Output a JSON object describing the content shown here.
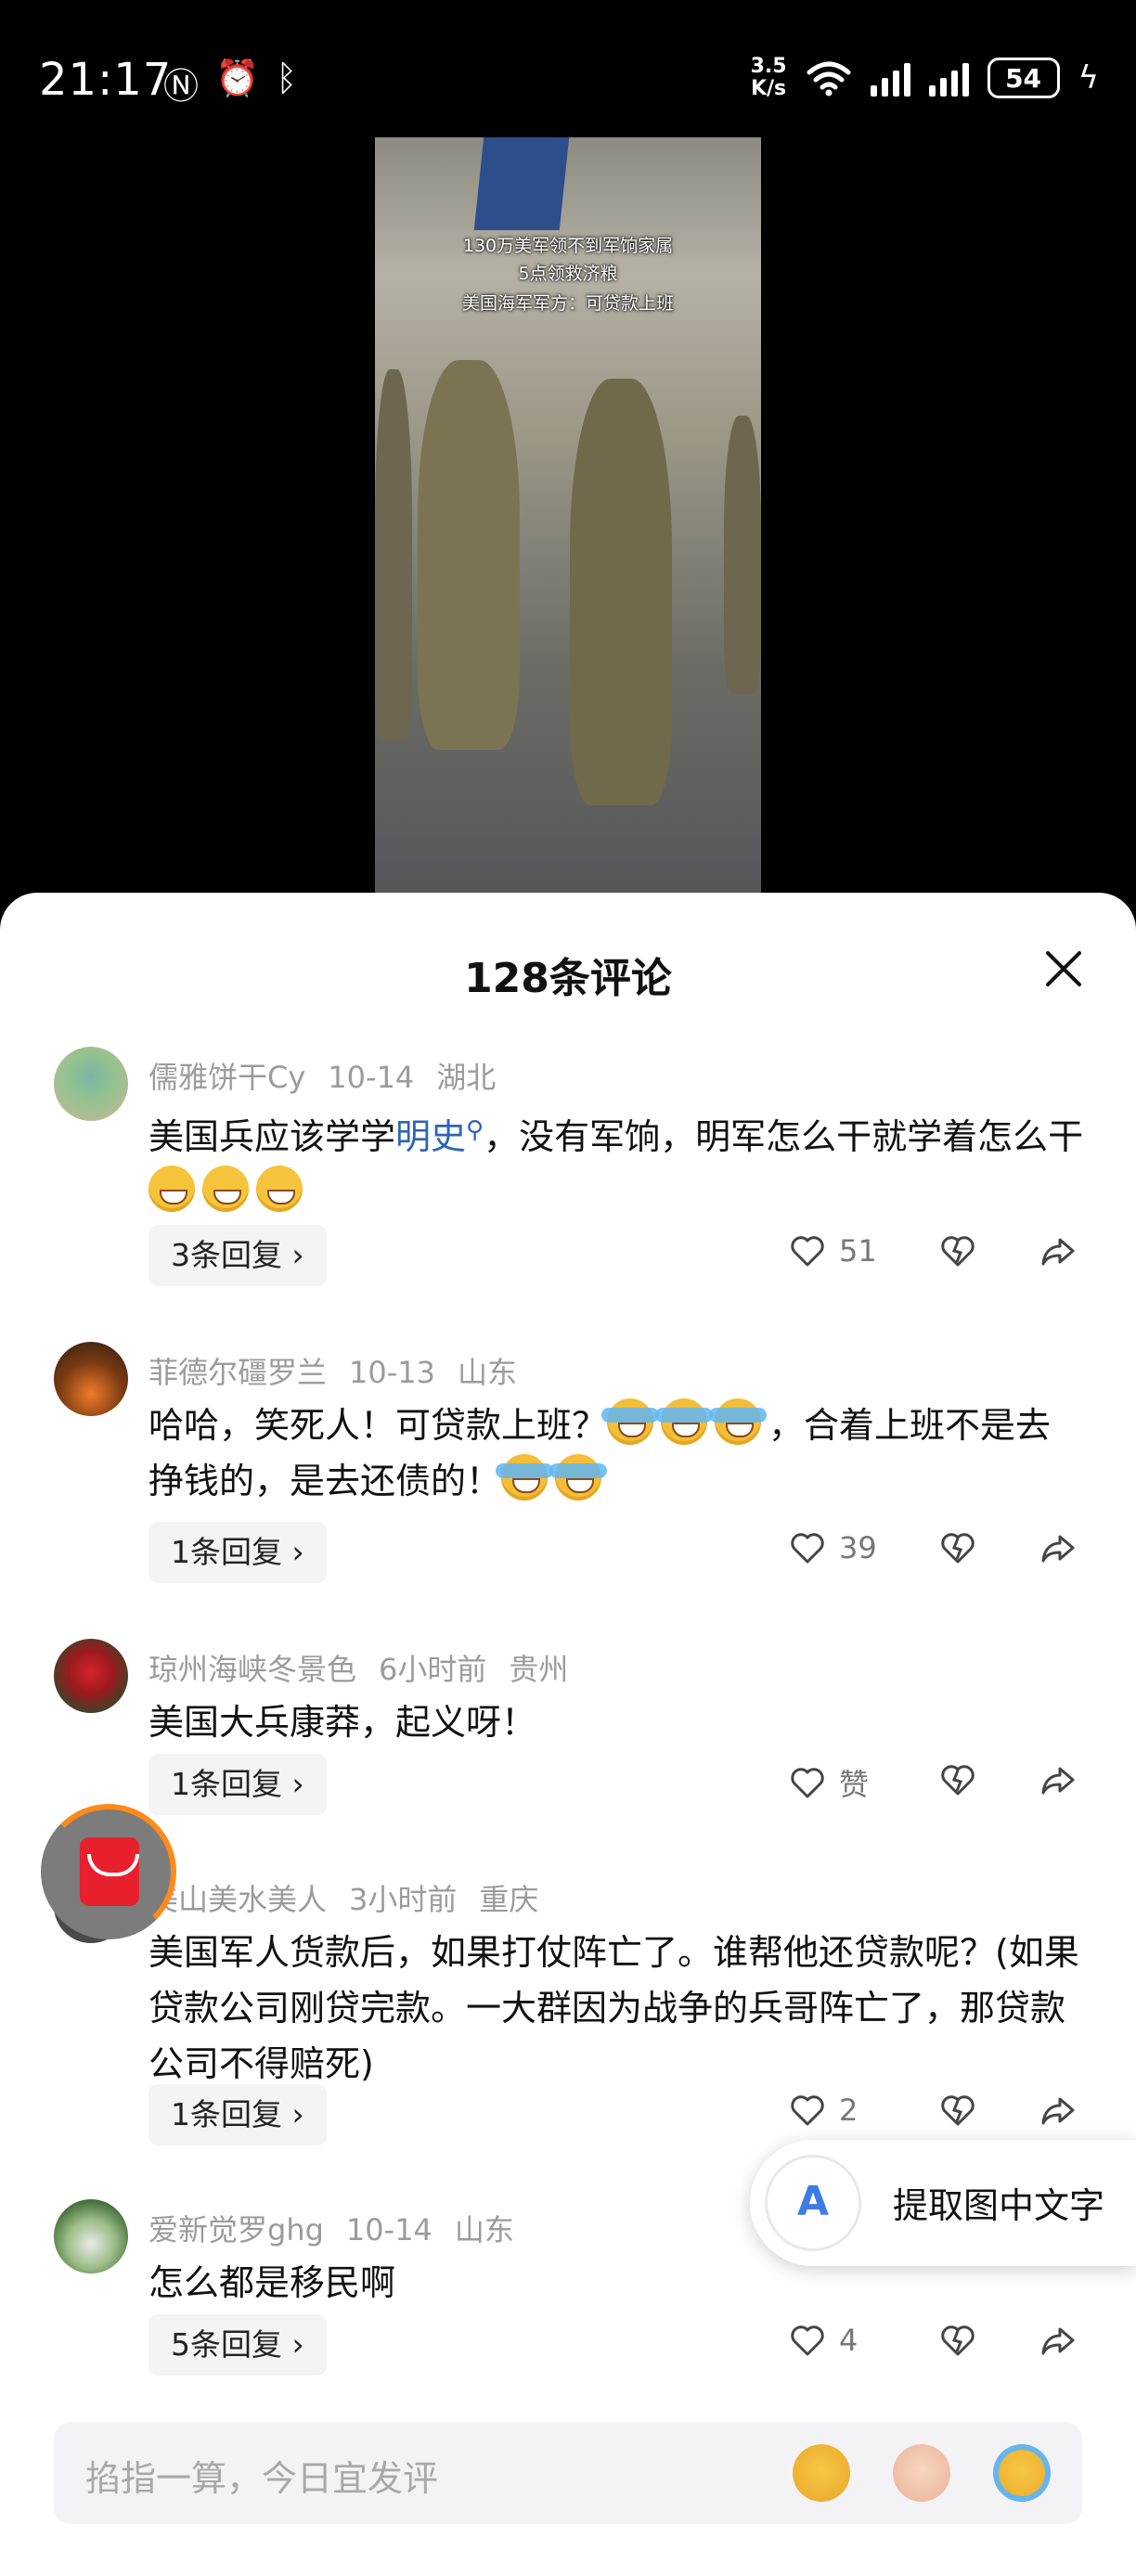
{
  "status_bar": {
    "time": "21:17",
    "net_speed_value": "3.5",
    "net_speed_unit": "K/s",
    "battery": "54"
  },
  "video": {
    "caption_line1": "130万美军领不到军饷家属",
    "caption_line2": "5点领救济粮",
    "caption_line3": "美国海军军方：可贷款上班"
  },
  "sheet": {
    "title": "128条评论"
  },
  "comments": [
    {
      "user": "儒雅饼干Cy",
      "date": "10-14",
      "location": "湖北",
      "text_before": "美国兵应该学学",
      "text_link": "明史",
      "text_after": "，没有军饷，明军怎么干就学着怎么干",
      "emoji": [
        "grin",
        "grin",
        "grin"
      ],
      "replies": "3条回复",
      "likes": "51"
    },
    {
      "user": "菲德尔礓罗兰",
      "date": "10-13",
      "location": "山东",
      "text_before": "哈哈，笑死人！可贷款上班？",
      "text_after": "，合着上班不是去挣钱的，是去还债的！",
      "replies": "1条回复",
      "likes": "39"
    },
    {
      "user": "琼州海峡冬景色",
      "date": "6小时前",
      "location": "贵州",
      "text": "美国大兵康莽，起义呀！",
      "replies": "1条回复",
      "likes": "赞"
    },
    {
      "user": "美山美水美人",
      "date": "3小时前",
      "location": "重庆",
      "text": "美国军人货款后，如果打仗阵亡了。谁帮他还贷款呢？(如果贷款公司刚贷完款。一大群因为战争的兵哥阵亡了，那贷款公司不得赔死)",
      "replies": "1条回复",
      "likes": "2"
    },
    {
      "user": "爱新觉罗ghg",
      "date": "10-14",
      "location": "山东",
      "text": "怎么都是移民啊",
      "replies": "5条回复",
      "likes": "4"
    }
  ],
  "ocr_button": {
    "label": "提取图中文字"
  },
  "input": {
    "placeholder": "掐指一算，今日宜发评"
  }
}
